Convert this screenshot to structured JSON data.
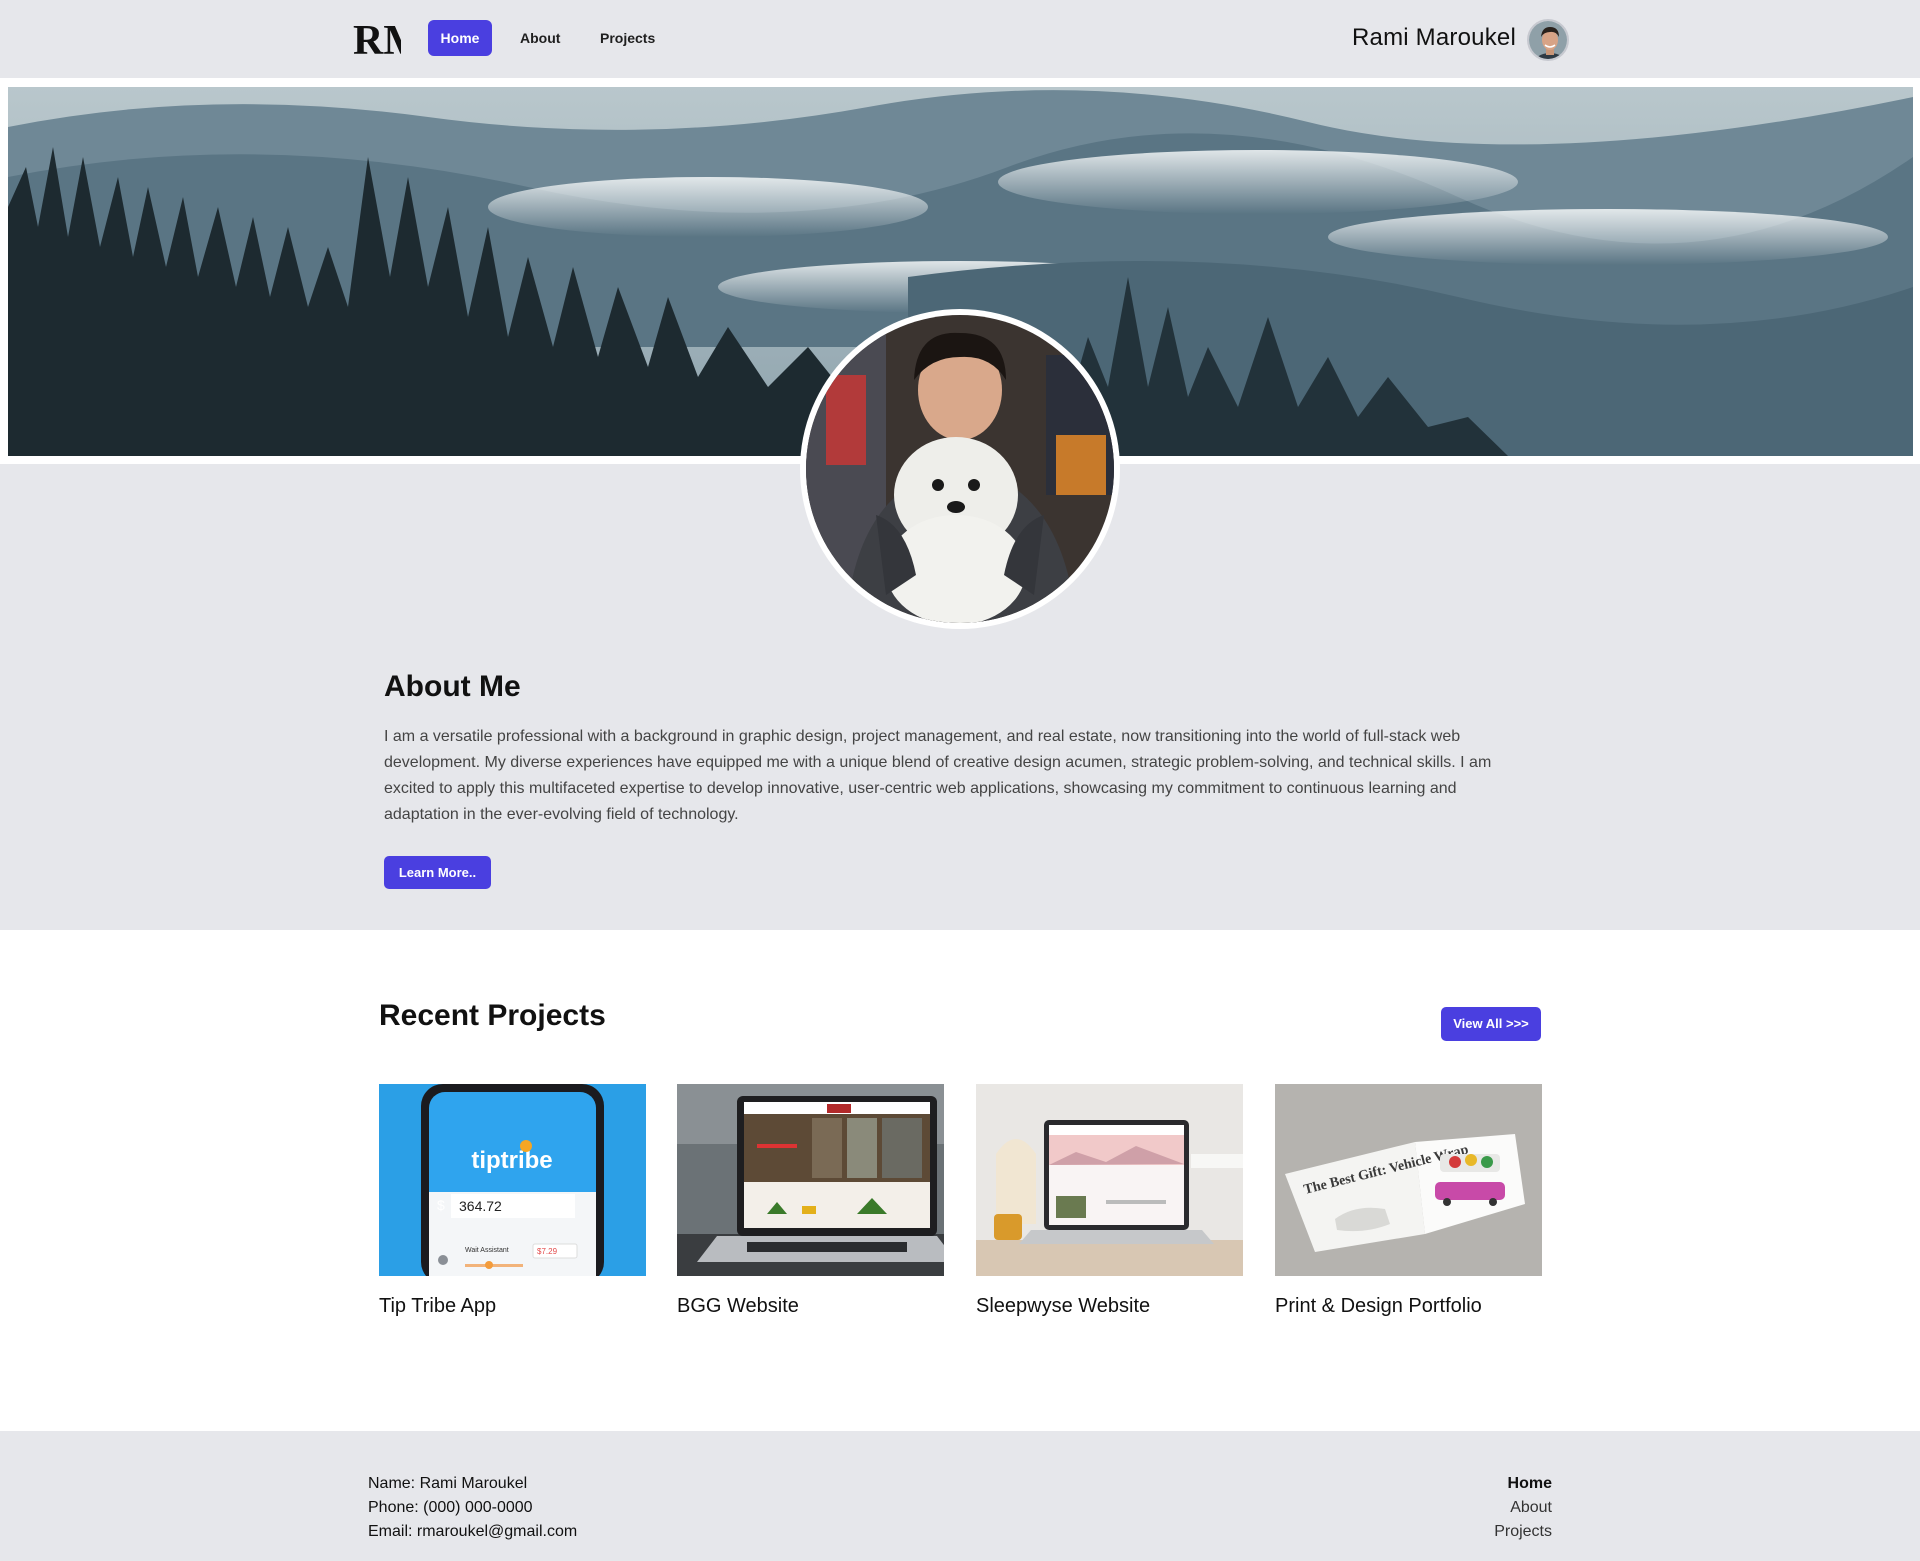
{
  "header": {
    "logo_text": "RM",
    "nav": [
      {
        "label": "Home",
        "active": true
      },
      {
        "label": "About",
        "active": false
      },
      {
        "label": "Projects",
        "active": false
      }
    ],
    "user_name": "Rami Maroukel"
  },
  "about": {
    "title": "About Me",
    "text": "I am a versatile professional with a background in graphic design, project management, and real estate, now transitioning into the world of full-stack web development. My diverse experiences have equipped me with a unique blend of creative design acumen, strategic problem-solving, and technical skills. I am excited to apply this multifaceted expertise to develop innovative, user-centric web applications, showcasing my commitment to continuous learning and adaptation in the ever-evolving field of technology.",
    "button": "Learn More.."
  },
  "projects": {
    "title": "Recent Projects",
    "view_all": "View All >>>",
    "items": [
      {
        "label": "Tip Tribe App",
        "app_name": "tiptribe",
        "amount": "364.72",
        "sub_label": "Wait Assistant",
        "sub_value": "$7.29",
        "currency": "$"
      },
      {
        "label": "BGG Website"
      },
      {
        "label": "Sleepwyse Website"
      },
      {
        "label": "Print & Design Portfolio",
        "book_text": "The Best Gift: Vehicle Wrap"
      }
    ]
  },
  "footer": {
    "name": "Name: Rami Maroukel",
    "phone": "Phone: (000) 000-0000",
    "email": "Email: rmaroukel@gmail.com",
    "links": [
      {
        "label": "Home",
        "active": true
      },
      {
        "label": "About",
        "active": false
      },
      {
        "label": "Projects",
        "active": false
      }
    ]
  },
  "colors": {
    "accent": "#4a3fe0",
    "band": "#e6e7eb"
  }
}
